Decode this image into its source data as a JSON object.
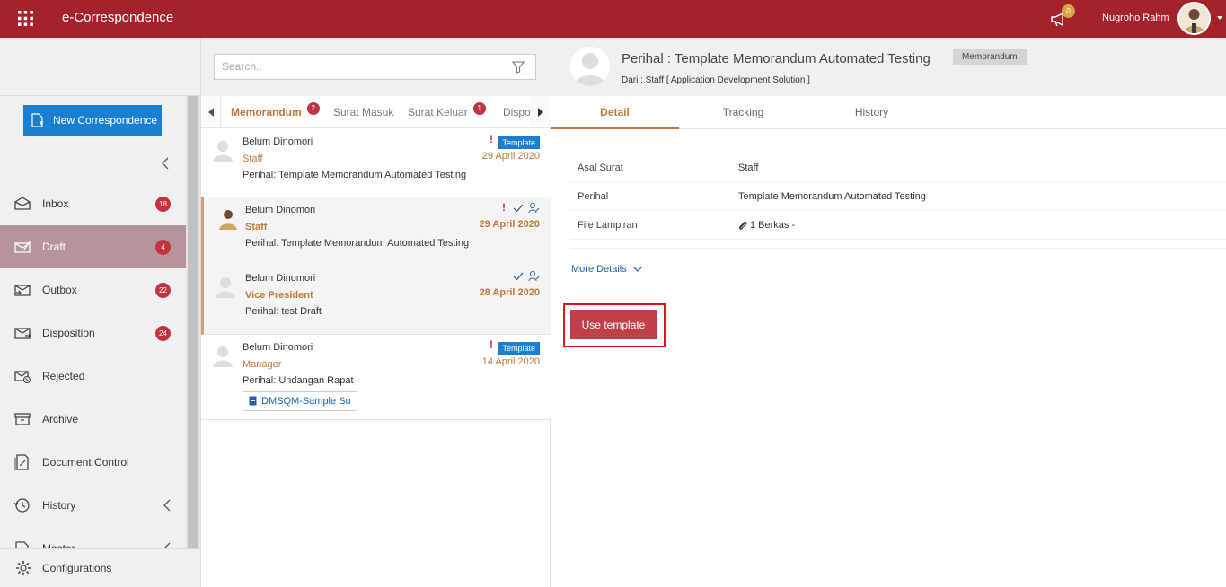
{
  "app": {
    "title": "e-Correspondence",
    "notification_count": "0",
    "user_name": "Nugroho Rahm",
    "brand_color": "#a3222c"
  },
  "sidebar": {
    "new_button_label": "New Correspondence",
    "items": [
      {
        "label": "Inbox",
        "badge": "18",
        "icon": "inbox-icon"
      },
      {
        "label": "Draft",
        "badge": "4",
        "icon": "draft-icon",
        "active": true
      },
      {
        "label": "Outbox",
        "badge": "22",
        "icon": "outbox-icon"
      },
      {
        "label": "Disposition",
        "badge": "24",
        "icon": "disposition-icon"
      },
      {
        "label": "Rejected",
        "badge": "",
        "icon": "rejected-icon"
      },
      {
        "label": "Archive",
        "badge": "",
        "icon": "archive-icon"
      },
      {
        "label": "Document Control",
        "badge": "",
        "icon": "document-control-icon"
      },
      {
        "label": "History",
        "badge": "",
        "icon": "history-icon"
      },
      {
        "label": "Master",
        "badge": "",
        "icon": "master-icon"
      }
    ],
    "config_label": "Configurations"
  },
  "list": {
    "search_placeholder": "Search..",
    "tabs": [
      {
        "label": "Memorandum",
        "badge": "2",
        "active": true
      },
      {
        "label": "Surat Masuk",
        "badge": ""
      },
      {
        "label": "Surat Keluar",
        "badge": "1"
      },
      {
        "label": "Dispo",
        "badge": ""
      }
    ],
    "messages": [
      {
        "sender": "Belum Dinomori",
        "role": "Staff",
        "subject": "Perihal: Template Memorandum Automated Testing",
        "date": "29 April 2020",
        "template_label": "Template",
        "important": "!"
      },
      {
        "sender": "Belum Dinomori",
        "role": "Staff",
        "subject": "Perihal: Template Memorandum Automated Testing",
        "date": "29 April 2020",
        "important": "!"
      },
      {
        "sender": "Belum Dinomori",
        "role": "Vice President",
        "subject": "Perihal: test Draft",
        "date": "28 April 2020"
      },
      {
        "sender": "Belum Dinomori",
        "role": "Manager",
        "subject": "Perihal: Undangan Rapat",
        "date": "14 April 2020",
        "template_label": "Template",
        "important": "!",
        "attachment": "DMSQM-Sample Su"
      }
    ]
  },
  "detail": {
    "title": "Perihal : Template Memorandum Automated Testing",
    "chip": "Memorandum",
    "from": "Dari : Staff [ Application Development Solution ]",
    "tabs": [
      "Detail",
      "Tracking",
      "History"
    ],
    "fields": [
      {
        "key": "Asal Surat",
        "value": "Staff"
      },
      {
        "key": "Perihal",
        "value": "Template Memorandum Automated Testing"
      },
      {
        "key": "File Lampiran",
        "value": "1 Berkas -"
      }
    ],
    "more_details": "More Details",
    "use_template": "Use template"
  }
}
